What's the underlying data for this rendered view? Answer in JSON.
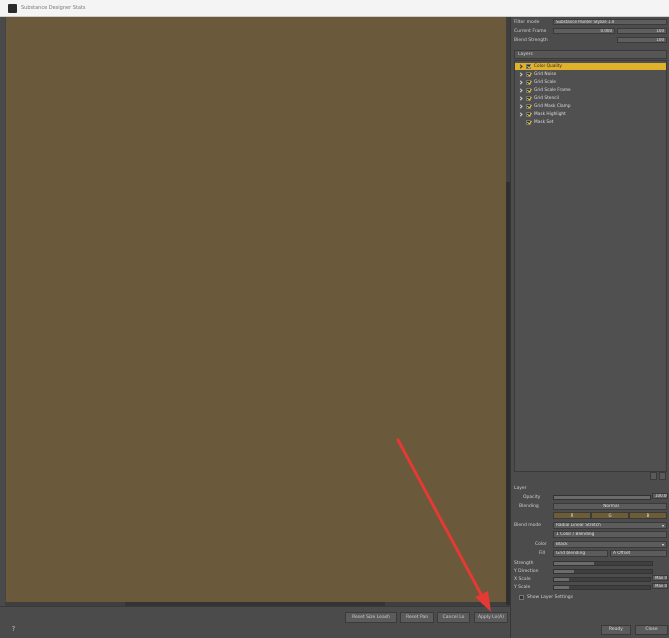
{
  "window": {
    "title": "Substance Designer Stats"
  },
  "bottom_bar": {
    "buttons": [
      "Reset Size Leash",
      "Reset Pan",
      "Cancel Lo",
      "Apply Lo(A)"
    ]
  },
  "right_panel": {
    "blend_mode_label": "Filter mode",
    "blend_mode_value": "Substance Painter Stylize 1.0",
    "amount_label": "Current Frame",
    "amount_value": "0.000",
    "amount_value2": "100",
    "scale_label": "Blend Strength",
    "scale_value": "100",
    "layers_header": "Layers",
    "layers": [
      {
        "label": "Color Quality",
        "selected": true,
        "expander": true
      },
      {
        "label": "Grid Noise",
        "selected": false,
        "expander": true
      },
      {
        "label": "Grid Scale",
        "selected": false,
        "expander": true
      },
      {
        "label": "Grid Scale Frame",
        "selected": false,
        "expander": true
      },
      {
        "label": "Grid Stencil",
        "selected": false,
        "expander": true
      },
      {
        "label": "Grid Mask Clamp",
        "selected": false,
        "expander": true
      },
      {
        "label": "Mask Highlight",
        "selected": false,
        "expander": true
      },
      {
        "label": "Mask Set",
        "selected": false,
        "expander": false
      }
    ],
    "properties": {
      "section_label": "Layer",
      "opacity_label": "Opacity",
      "opacity_value": "100.00",
      "blending_label": "Blending",
      "blending_value": "Normal",
      "channel_r": "R",
      "channel_g": "G",
      "channel_b": "B",
      "mode_label": "Blend mode",
      "mode_value": "Radial Linear Stretch",
      "option_value": "1 Color / Blending",
      "color_label": "Color",
      "color_value": "Black",
      "fill_label": "Fill",
      "fill_a": "Grid blending",
      "fill_b": "A Offset",
      "param1_label": "Strength",
      "param2_label": "Y Direction",
      "param3_label": "X Scale",
      "param4_label": "Y Scale",
      "param4_value": "Max 0",
      "param3_value": "Max 0",
      "checkbox_label": "Show Layer Settings"
    },
    "footer": {
      "ok_label": "Ready",
      "cancel_label": "Close"
    }
  },
  "colors": {
    "preview_bg": "#6a593a",
    "selection": "#e0b12a",
    "arrow": "#e53935"
  }
}
